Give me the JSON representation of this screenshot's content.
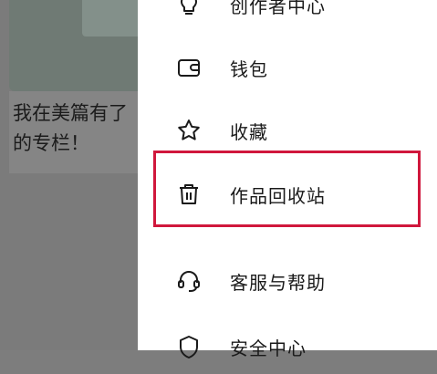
{
  "background": {
    "card_text": "我在美篇有了\n的专栏！"
  },
  "drawer": {
    "items": [
      {
        "label": "创作者中心",
        "icon": "lightbulb-icon"
      },
      {
        "label": "钱包",
        "icon": "wallet-icon"
      },
      {
        "label": "收藏",
        "icon": "star-icon"
      },
      {
        "label": "作品回收站",
        "icon": "trash-icon"
      },
      {
        "label": "客服与帮助",
        "icon": "headset-icon"
      },
      {
        "label": "安全中心",
        "icon": "shield-icon"
      }
    ]
  },
  "colors": {
    "highlight_border": "#d0173c",
    "overlay": "#7d7d7d"
  }
}
